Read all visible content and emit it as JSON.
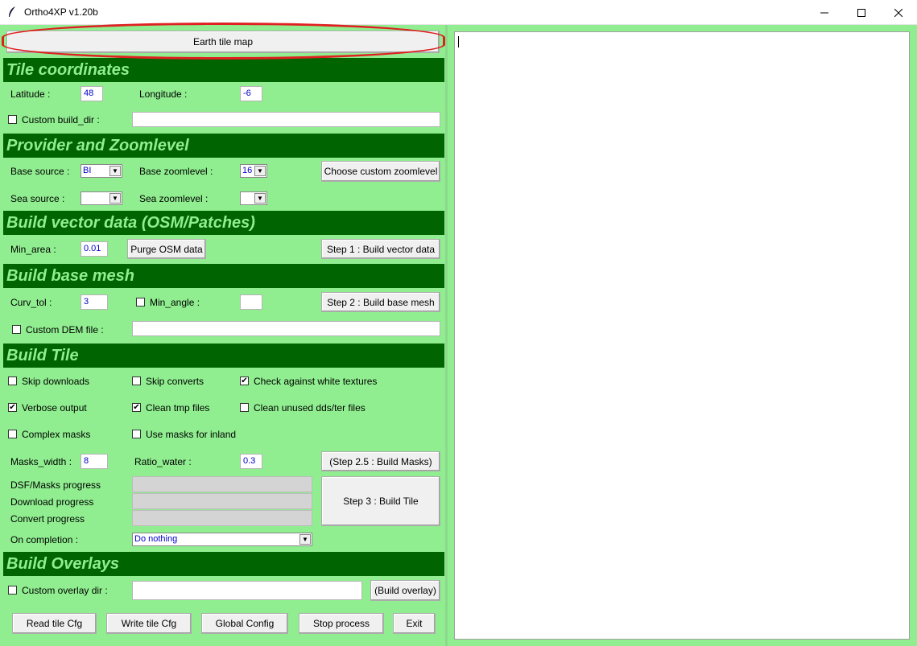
{
  "window": {
    "title": "Ortho4XP  v1.20b",
    "controls": {
      "minimize": "—",
      "maximize": "☐",
      "close": "✕"
    }
  },
  "earth_tile_map_label": "Earth tile map",
  "sections": {
    "tile_coordinates": "Tile coordinates",
    "provider": "Provider and Zoomlevel",
    "vector": "Build vector data (OSM/Patches)",
    "mesh": "Build base mesh",
    "tile": "Build Tile",
    "overlays": "Build Overlays"
  },
  "coords": {
    "lat_label": "Latitude :",
    "lat_value": "48",
    "lon_label": "Longitude :",
    "lon_value": "-6",
    "custom_build_dir_label": "Custom build_dir :",
    "custom_build_dir_value": ""
  },
  "provider": {
    "base_source_label": "Base source :",
    "base_source_value": "BI",
    "base_zoom_label": "Base zoomlevel :",
    "base_zoom_value": "16",
    "choose_zoom_label": "Choose custom zoomlevel",
    "sea_source_label": "Sea source :",
    "sea_source_value": "",
    "sea_zoom_label": "Sea zoomlevel :",
    "sea_zoom_value": ""
  },
  "vector": {
    "min_area_label": "Min_area :",
    "min_area_value": "0.01",
    "purge_label": "Purge OSM data",
    "step1_label": "Step 1 : Build vector data"
  },
  "mesh": {
    "curv_tol_label": "Curv_tol :",
    "curv_tol_value": "3",
    "min_angle_label": "Min_angle :",
    "min_angle_value": "",
    "step2_label": "Step 2 : Build base mesh",
    "custom_dem_label": "Custom DEM file :",
    "custom_dem_value": ""
  },
  "tile": {
    "skip_downloads": "Skip downloads",
    "skip_converts": "Skip converts",
    "check_white": "Check against white textures",
    "verbose": "Verbose output",
    "clean_tmp": "Clean tmp files",
    "clean_unused": "Clean unused dds/ter files",
    "complex_masks": "Complex masks",
    "use_masks_inland": "Use masks for inland",
    "masks_width_label": "Masks_width :",
    "masks_width_value": "8",
    "ratio_water_label": "Ratio_water :",
    "ratio_water_value": "0.3",
    "step25_label": "(Step 2.5 : Build Masks)",
    "dsf_progress_label": "DSF/Masks progress",
    "download_progress_label": "Download progress",
    "convert_progress_label": "Convert progress",
    "step3_label": "Step 3 : Build Tile",
    "on_completion_label": "On completion :",
    "on_completion_value": "Do nothing",
    "checked": {
      "skip_downloads": "☐",
      "skip_converts": "☐",
      "check_white": "✔",
      "verbose": "✔",
      "clean_tmp": "✔",
      "clean_unused": "☐",
      "complex_masks": "☐",
      "use_masks_inland": "☐"
    }
  },
  "overlays": {
    "custom_overlay_label": "Custom overlay dir :",
    "custom_overlay_value": "",
    "build_overlay_label": "(Build overlay)"
  },
  "footer": {
    "read_cfg": "Read tile Cfg",
    "write_cfg": "Write tile Cfg",
    "global_config": "Global Config",
    "stop_process": "Stop process",
    "exit": "Exit"
  },
  "colors": {
    "panel_bg": "#90ee90",
    "section_bg": "#006400",
    "highlight": "#e02020"
  }
}
